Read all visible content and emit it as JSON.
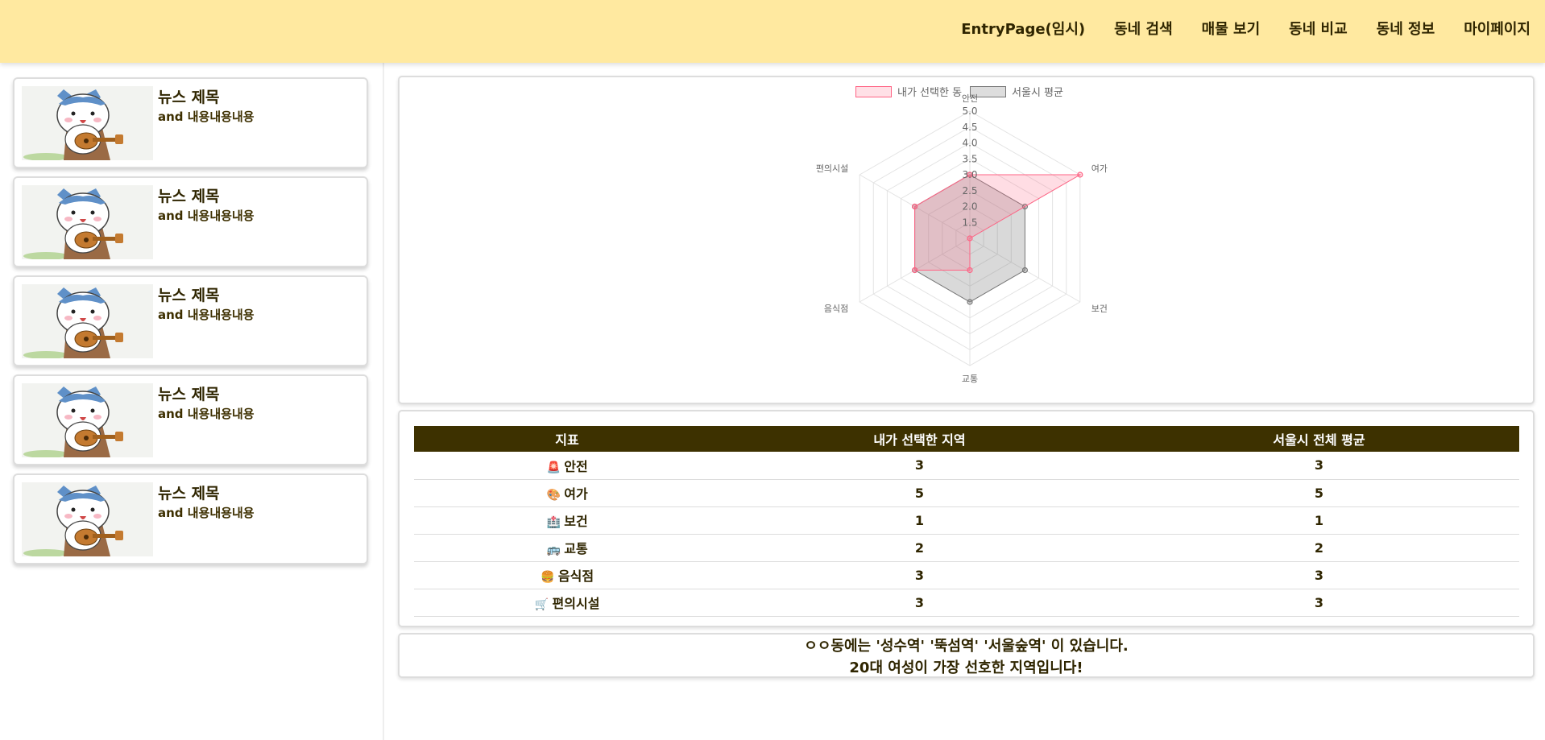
{
  "nav": {
    "items": [
      "EntryPage(임시)",
      "동네 검색",
      "매물 보기",
      "동네 비교",
      "동네 정보",
      "마이페이지"
    ]
  },
  "news": {
    "items": [
      {
        "title": "뉴스 제목",
        "body": "and 내용내용내용"
      },
      {
        "title": "뉴스 제목",
        "body": "and 내용내용내용"
      },
      {
        "title": "뉴스 제목",
        "body": "and 내용내용내용"
      },
      {
        "title": "뉴스 제목",
        "body": "and 내용내용내용"
      },
      {
        "title": "뉴스 제목",
        "body": "and 내용내용내용"
      }
    ]
  },
  "chart_data": {
    "type": "radar",
    "labels": [
      "안전",
      "여가",
      "보건",
      "교통",
      "음식점",
      "편의시설"
    ],
    "rlim": [
      1,
      5
    ],
    "ticks": [
      "1.5",
      "2.0",
      "2.5",
      "3.0",
      "3.5",
      "4.0",
      "4.5",
      "5.0"
    ],
    "legend_position": "top",
    "series": [
      {
        "name": "내가 선택한 동",
        "values": [
          3,
          5,
          1,
          2,
          3,
          3
        ],
        "color": "#ff6384"
      },
      {
        "name": "서울시 평균",
        "values": [
          3,
          3,
          3,
          3,
          3,
          3
        ],
        "color": "#9e9e9e"
      }
    ]
  },
  "table": {
    "headers": [
      "지표",
      "내가 선택한 지역",
      "서울시 전체 평균"
    ],
    "rows": [
      {
        "icon": "🚨",
        "name": "안전",
        "mine": "3",
        "avg": "3"
      },
      {
        "icon": "🎨",
        "name": "여가",
        "mine": "5",
        "avg": "5"
      },
      {
        "icon": "🏥",
        "name": "보건",
        "mine": "1",
        "avg": "1"
      },
      {
        "icon": "🚌",
        "name": "교통",
        "mine": "2",
        "avg": "2"
      },
      {
        "icon": "🍔",
        "name": "음식점",
        "mine": "3",
        "avg": "3"
      },
      {
        "icon": "🛒",
        "name": "편의시설",
        "mine": "3",
        "avg": "3"
      }
    ]
  },
  "info": {
    "line1": "ㅇㅇ동에는 '성수역' '뚝섬역' '서울숲역' 이 있습니다.",
    "line2": "20대 여성이 가장 선호한 지역입니다!"
  },
  "colors": {
    "header_bg": "#ffe9a0",
    "table_head": "#3d3100",
    "mine": "#ff6384",
    "avg": "#9e9e9e"
  }
}
